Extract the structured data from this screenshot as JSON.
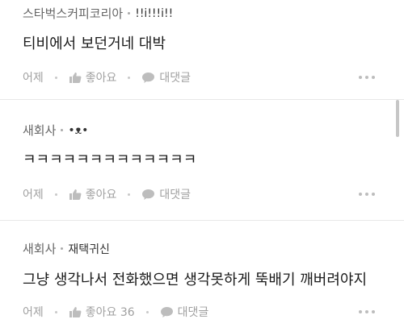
{
  "comments": [
    {
      "author": "스타벅스커피코리아",
      "nickname": "!!i!!!i!!",
      "text": "티비에서 보던거네 대박",
      "time": "어제",
      "like_label": "좋아요",
      "reply_label": "대댓글"
    },
    {
      "author": "새회사",
      "nickname": "•ᴥ•",
      "text": "ㅋㅋㅋㅋㅋㅋㅋㅋㅋㅋㅋㅋㅋ",
      "time": "어제",
      "like_label": "좋아요",
      "reply_label": "대댓글"
    },
    {
      "author": "새회사",
      "nickname": "재택귀신",
      "text": "그냥 생각나서 전화했으면 생각못하게 뚝배기 깨버려야지",
      "time": "어제",
      "like_label": "좋아요 36",
      "reply_label": "대댓글"
    }
  ],
  "icons": {
    "like": "thumbs-up-icon",
    "reply": "speech-bubble-icon",
    "more": "more-dots-icon"
  },
  "colors": {
    "meta_text": "#666666",
    "action_text": "#a0a0a0",
    "divider": "#e8e8e8"
  }
}
